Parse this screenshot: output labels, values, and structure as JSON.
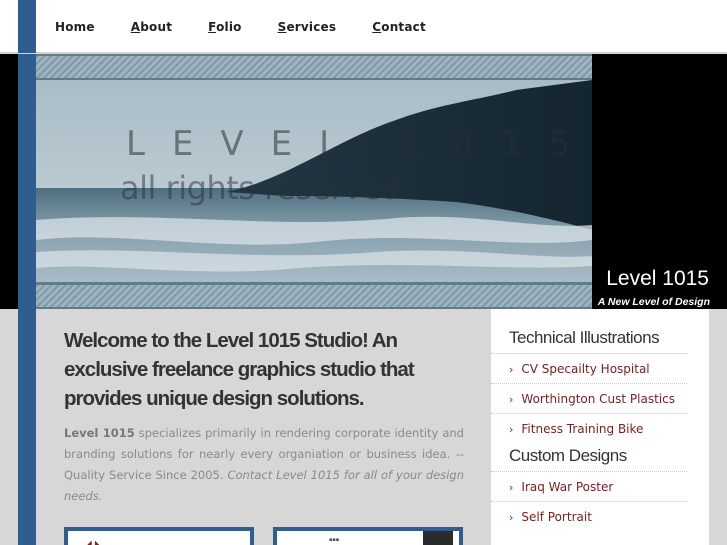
{
  "nav": {
    "items": [
      {
        "label": "Home",
        "accel": ""
      },
      {
        "label": "About",
        "accel": "A",
        "rest": "bout"
      },
      {
        "label": "Folio",
        "accel": "F",
        "rest": "olio"
      },
      {
        "label": "Services",
        "accel": "S",
        "rest": "ervices"
      },
      {
        "label": "Contact",
        "accel": "C",
        "rest": "ontact"
      }
    ]
  },
  "banner": {
    "watermark_line1": "LEVEL 1015",
    "watermark_line2": "all rights reserved",
    "brand": "Level 1015",
    "tagline": "A New Level of Design"
  },
  "main": {
    "headline": "Welcome to the Level 1015 Studio! An exclusive freelance graphics studio that provides unique design solutions.",
    "intro_bold": "Level 1015",
    "intro_text": " specializes primarily in rendering corporate identity and branding solutions for nearly every organiation or business idea. -- Quality Service Since 2005. ",
    "intro_italic": "Contact Level 1015 for all of your design needs."
  },
  "sidebar": {
    "section1_title": "Technical Illustrations",
    "section1_items": [
      "CV Specailty Hospital",
      "Worthington Cust Plastics",
      "Fitness Training Bike"
    ],
    "section2_title": "Custom Designs",
    "section2_items": [
      "Iraq War Poster",
      "Self Portrait"
    ]
  },
  "colors": {
    "accent_blue": "#2f5d8f",
    "link_red": "#7a1f1f"
  }
}
